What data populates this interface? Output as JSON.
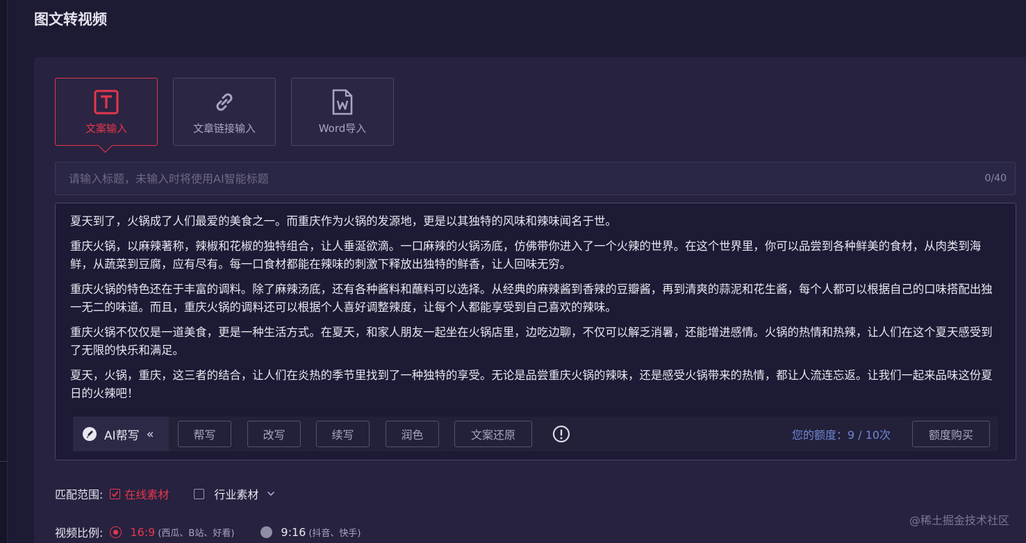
{
  "page": {
    "title": "图文转视频"
  },
  "tabs": [
    {
      "label": "文案输入",
      "icon": "text-t-icon",
      "active": true
    },
    {
      "label": "文章链接输入",
      "icon": "link-icon",
      "active": false
    },
    {
      "label": "Word导入",
      "icon": "word-file-icon",
      "active": false
    }
  ],
  "title_input": {
    "placeholder": "请输入标题，未输入时将使用AI智能标题",
    "value": "",
    "counter": "0/40"
  },
  "body": {
    "paragraphs": [
      "夏天到了，火锅成了人们最爱的美食之一。而重庆作为火锅的发源地，更是以其独特的风味和辣味闻名于世。",
      "重庆火锅，以麻辣著称，辣椒和花椒的独特组合，让人垂涎欲滴。一口麻辣的火锅汤底，仿佛带你进入了一个火辣的世界。在这个世界里，你可以品尝到各种鲜美的食材，从肉类到海鲜，从蔬菜到豆腐，应有尽有。每一口食材都能在辣味的刺激下释放出独特的鲜香，让人回味无穷。",
      "重庆火锅的特色还在于丰富的调料。除了麻辣汤底，还有各种酱料和蘸料可以选择。从经典的麻辣酱到香辣的豆瓣酱，再到清爽的蒜泥和花生酱，每个人都可以根据自己的口味搭配出独一无二的味道。而且，重庆火锅的调料还可以根据个人喜好调整辣度，让每个人都能享受到自己喜欢的辣味。",
      "重庆火锅不仅仅是一道美食，更是一种生活方式。在夏天，和家人朋友一起坐在火锅店里，边吃边聊，不仅可以解乏消暑，还能增进感情。火锅的热情和热辣，让人们在这个夏天感受到了无限的快乐和满足。",
      "夏天，火锅，重庆，这三者的结合，让人们在炎热的季节里找到了一种独特的享受。无论是品尝重庆火锅的辣味，还是感受火锅带来的热情，都让人流连忘返。让我们一起来品味这份夏日的火辣吧！"
    ]
  },
  "ai_toolbar": {
    "brand": "AI帮写",
    "collapse": "«",
    "buttons": [
      "帮写",
      "改写",
      "续写",
      "润色",
      "文案还原"
    ],
    "info_icon": "exclamation-circle-icon",
    "quota": "您的额度：9 / 10次",
    "buy": "额度购买"
  },
  "match_scope": {
    "label": "匹配范围:",
    "options": [
      {
        "label": "在线素材",
        "checked": true
      },
      {
        "label": "行业素材",
        "checked": false
      }
    ]
  },
  "video_ratio": {
    "label": "视频比例:",
    "options": [
      {
        "label": "16:9",
        "note": "(西瓜、B站、好看)",
        "selected": true
      },
      {
        "label": "9:16",
        "note": "(抖音、快手)",
        "selected": false
      }
    ]
  },
  "watermark": "@稀土掘金技术社区",
  "colors": {
    "accent": "#e5374c",
    "quota": "#6f86d6",
    "panel": "#26223f",
    "background": "#1d1a33"
  }
}
